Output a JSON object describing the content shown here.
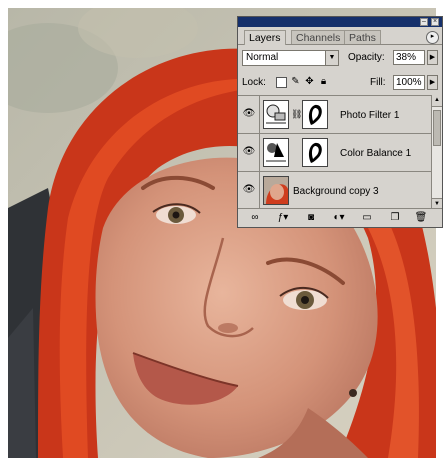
{
  "palette": {
    "tabs": [
      {
        "label": "Layers",
        "active": true
      },
      {
        "label": "Channels",
        "active": false
      },
      {
        "label": "Paths",
        "active": false
      }
    ],
    "blend_mode": "Normal",
    "opacity_label": "Opacity:",
    "opacity_value": "38%",
    "lock_label": "Lock:",
    "fill_label": "Fill:",
    "fill_value": "100%",
    "layers": [
      {
        "name": "Photo Filter 1",
        "visible": true,
        "thumb": "photo-filter-adjustment-icon",
        "has_mask": true
      },
      {
        "name": "Color Balance 1",
        "visible": true,
        "thumb": "color-balance-adjustment-icon",
        "has_mask": true
      },
      {
        "name": "Background copy 3",
        "visible": true,
        "thumb": "portrait-thumbnail",
        "has_mask": false
      }
    ],
    "bottom_icons": [
      "link-layers-icon",
      "layer-style-icon",
      "add-mask-icon",
      "new-adjustment-layer-icon",
      "new-group-icon",
      "new-layer-icon",
      "delete-layer-icon"
    ]
  },
  "colors": {
    "titlebar": "#15306b",
    "panel": "#d6d3ce",
    "hair": "#d4401c",
    "skin": "#d99a80"
  }
}
